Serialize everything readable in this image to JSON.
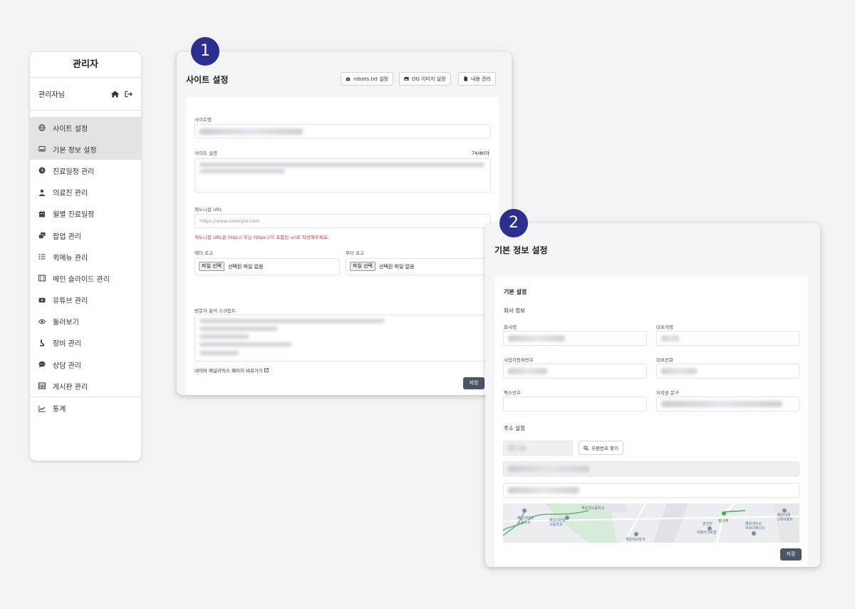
{
  "sidebar": {
    "title": "관리자",
    "user": "관리자님",
    "items": [
      {
        "label": "사이트 설정",
        "icon": "globe-icon"
      },
      {
        "label": "기본 정보 설정",
        "icon": "monitor-icon"
      },
      {
        "label": "진료일정 관리",
        "icon": "clock-icon"
      },
      {
        "label": "의료진 관리",
        "icon": "doctor-icon"
      },
      {
        "label": "월별 진료일정",
        "icon": "calendar-icon"
      },
      {
        "label": "팝업 관리",
        "icon": "popup-icon"
      },
      {
        "label": "퀵메뉴 관리",
        "icon": "list-icon"
      },
      {
        "label": "메인 슬라이드 관리",
        "icon": "film-icon"
      },
      {
        "label": "유튜브 관리",
        "icon": "youtube-icon"
      },
      {
        "label": "둘러보기",
        "icon": "eye-icon"
      },
      {
        "label": "장비 관리",
        "icon": "equipment-icon"
      },
      {
        "label": "상담 관리",
        "icon": "chat-icon"
      },
      {
        "label": "게시판 관리",
        "icon": "table-icon"
      },
      {
        "label": "통계",
        "icon": "chart-icon"
      }
    ]
  },
  "panel1": {
    "badge": "1",
    "title": "사이트 설정",
    "buttons": {
      "robots": "robots.txt 설정",
      "og": "OG 이미지 설정",
      "content": "내용 관리"
    },
    "site_name_label": "사이트명",
    "site_desc_label": "사이트 설명",
    "char_count": "74/80자",
    "canonical_label": "캐노니컬 URL",
    "canonical_placeholder": "https://www.example.com",
    "canonical_error": "캐노니컬 URL은 http:// 또는 https://가 포함된 url로 작성해주세요.",
    "header_logo_label": "헤더 로고",
    "footer_logo_label": "푸터 로고",
    "file_button": "파일 선택",
    "file_none": "선택된 파일 없음",
    "script_label": "방문자 분석 스크립트",
    "naver_link": "네이버 애널리틱스 페이지 바로가기",
    "save": "저장"
  },
  "panel2": {
    "badge": "2",
    "title": "기본 정보 설정",
    "section": "기본 설정",
    "company_section": "회사 정보",
    "company_name_label": "회사명",
    "ceo_label": "대표자명",
    "business_no_label": "사업자등록번호",
    "phone_label": "대표전화",
    "fax_label": "팩스번호",
    "copyright_label": "저작권 문구",
    "address_section": "주소 설정",
    "postcode_button": "우편번호 찾기",
    "save": "저장",
    "map_labels": [
      "해운대여자\n고등학교",
      "해운대관광\n고등학교",
      "해운대고등학교",
      "춘천천",
      "장산역",
      "대림아크로빌",
      "해운대소방서",
      "해운대두산\n위브더제니스",
      "해운대경\n2차아파트"
    ]
  }
}
